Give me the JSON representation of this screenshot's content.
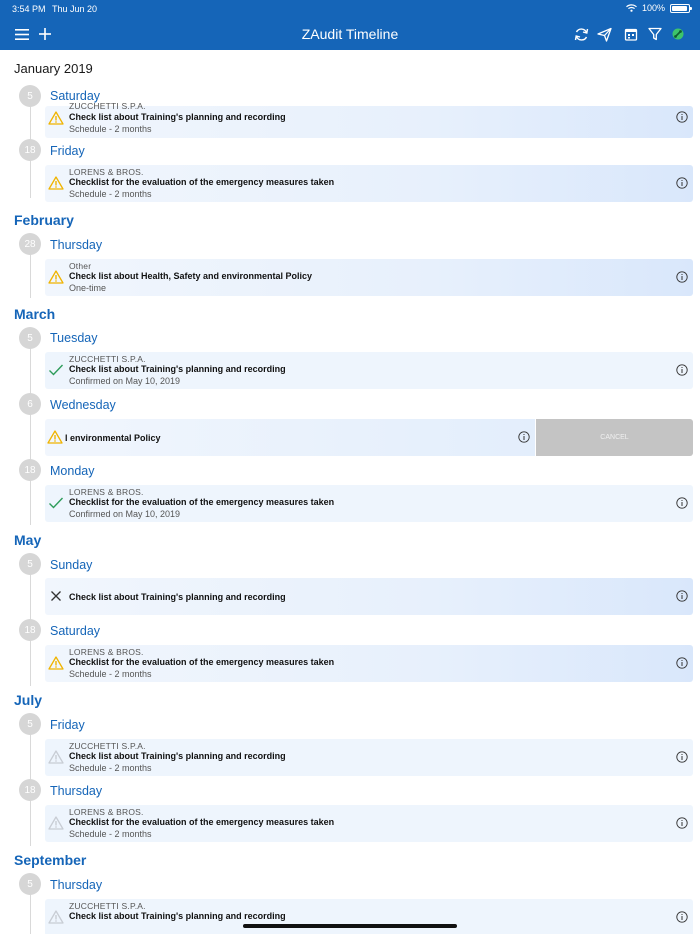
{
  "status_bar": {
    "time": "3:54 PM",
    "date": "Thu Jun 20",
    "battery": "100%"
  },
  "nav": {
    "title": "ZAudit Timeline",
    "left_icons": [
      "menu-icon",
      "add-icon"
    ],
    "right_icons": [
      "sync-icon",
      "send-icon",
      "calendar-icon",
      "filter-icon",
      "connection-icon"
    ]
  },
  "colors": {
    "accent": "#1565b8",
    "warning": "#f0b400",
    "confirmed": "#2e9c5a"
  },
  "timeline": {
    "first_month": "January 2019",
    "months": {
      "feb": "February",
      "mar": "March",
      "may": "May",
      "jul": "July",
      "sep": "September"
    },
    "days": {
      "jan5": {
        "num": "5",
        "name": "Saturday"
      },
      "jan18": {
        "num": "18",
        "name": "Friday"
      },
      "feb28": {
        "num": "28",
        "name": "Thursday"
      },
      "mar5": {
        "num": "5",
        "name": "Tuesday"
      },
      "mar6": {
        "num": "6",
        "name": "Wednesday"
      },
      "mar18": {
        "num": "18",
        "name": "Monday"
      },
      "may5": {
        "num": "5",
        "name": "Sunday"
      },
      "may18": {
        "num": "18",
        "name": "Saturday"
      },
      "jul5": {
        "num": "5",
        "name": "Friday"
      },
      "jul18": {
        "num": "18",
        "name": "Thursday"
      },
      "sep5": {
        "num": "5",
        "name": "Thursday"
      }
    },
    "cards": {
      "jan5": {
        "company": "ZUCCHETTI S.P.A.",
        "title": "Check list about Training's planning and recording",
        "sub": "Schedule - 2 months",
        "status": "warning"
      },
      "jan18": {
        "company": "LORENS & BROS.",
        "title": "Checklist for the evaluation of the emergency measures taken",
        "sub": "Schedule - 2 months",
        "status": "warning"
      },
      "feb28": {
        "company": "Other",
        "title": "Check list about Health, Safety and environmental Policy",
        "sub": "One-time",
        "status": "warning"
      },
      "mar5": {
        "company": "ZUCCHETTI S.P.A.",
        "title": "Check list about Training's planning and recording",
        "sub": "Confirmed on May 10, 2019",
        "status": "confirmed"
      },
      "mar6": {
        "title": "l environmental Policy",
        "cancel": "CANCEL",
        "status": "warning"
      },
      "mar18": {
        "company": "LORENS & BROS.",
        "title": "Checklist for the evaluation of the emergency measures taken",
        "sub": "Confirmed on May 10, 2019",
        "status": "confirmed"
      },
      "may5": {
        "title": "Check list about Training's planning and recording",
        "status": "cancelled"
      },
      "may18": {
        "company": "LORENS & BROS.",
        "title": "Checklist for the evaluation of the emergency measures taken",
        "sub": "Schedule - 2 months",
        "status": "warning"
      },
      "jul5": {
        "company": "ZUCCHETTI S.P.A.",
        "title": "Check list about Training's planning and recording",
        "sub": "Schedule - 2 months",
        "status": "future"
      },
      "jul18": {
        "company": "LORENS & BROS.",
        "title": "Checklist for the evaluation of the emergency measures taken",
        "sub": "Schedule - 2 months",
        "status": "future"
      },
      "sep5": {
        "company": "ZUCCHETTI S.P.A.",
        "title": "Check list about Training's planning and recording",
        "status": "future"
      }
    }
  }
}
